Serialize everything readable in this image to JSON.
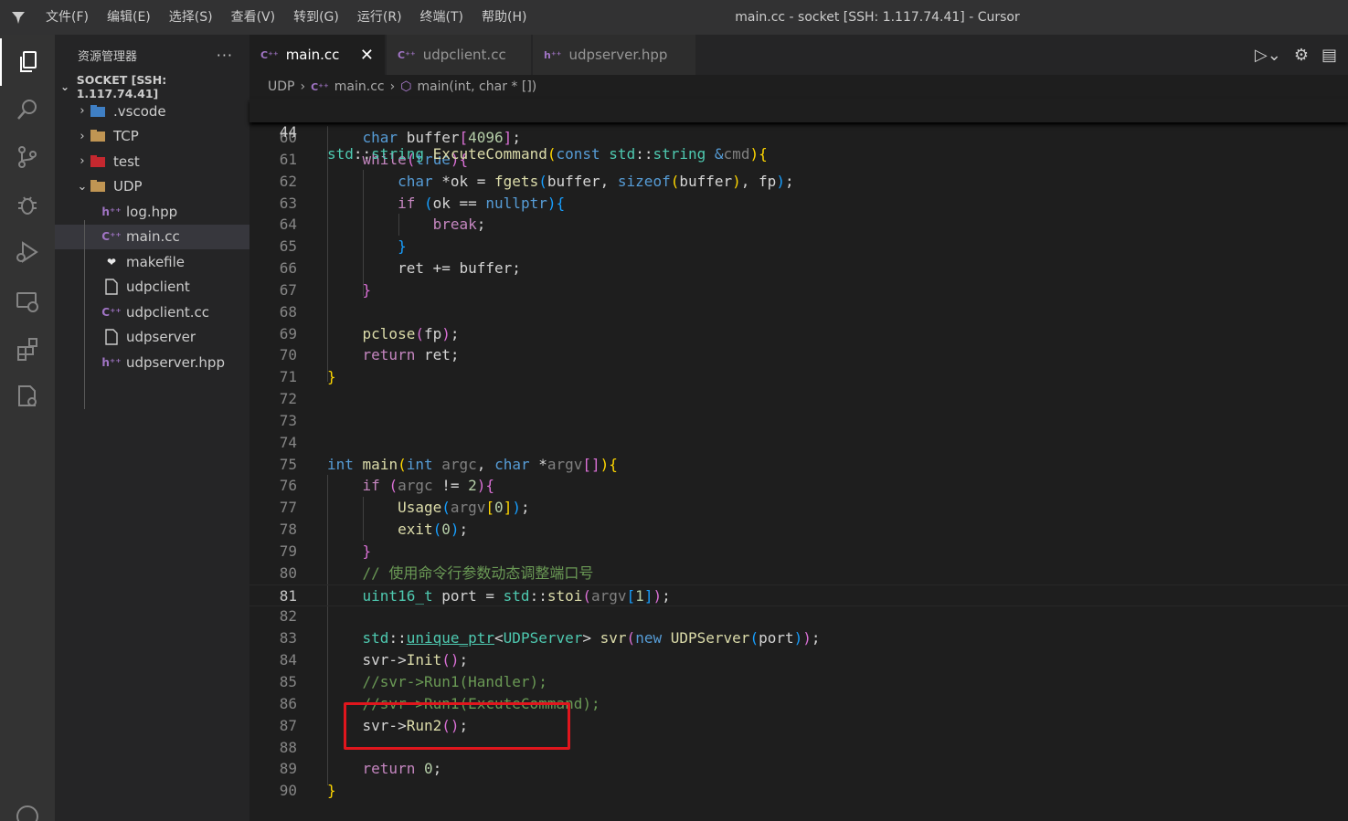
{
  "titlebar": {
    "menu": [
      "文件(F)",
      "编辑(E)",
      "选择(S)",
      "查看(V)",
      "转到(G)",
      "运行(R)",
      "终端(T)",
      "帮助(H)"
    ],
    "window_title": "main.cc - socket [SSH: 1.117.74.41] - Cursor"
  },
  "activitybar": {
    "icons": [
      "explorer-icon",
      "search-icon",
      "source-control-icon",
      "debug-icon",
      "run-debug-icon",
      "remote-explorer-icon",
      "extensions-icon",
      "remote-settings-icon"
    ]
  },
  "sidebar": {
    "title": "资源管理器",
    "more": "···",
    "section_title": "SOCKET [SSH: 1.117.74.41]",
    "items": [
      {
        "label": ".vscode",
        "type": "folder"
      },
      {
        "label": "TCP",
        "type": "folder"
      },
      {
        "label": "test",
        "type": "folder"
      },
      {
        "label": "UDP",
        "type": "folder-open"
      },
      {
        "label": "log.hpp",
        "type": "hpp"
      },
      {
        "label": "main.cc",
        "type": "cc"
      },
      {
        "label": "makefile",
        "type": "makefile"
      },
      {
        "label": "udpclient",
        "type": "file"
      },
      {
        "label": "udpclient.cc",
        "type": "cc"
      },
      {
        "label": "udpserver",
        "type": "file"
      },
      {
        "label": "udpserver.hpp",
        "type": "hpp"
      }
    ]
  },
  "tabs": [
    {
      "label": "main.cc",
      "active": true,
      "close": "✕"
    },
    {
      "label": "udpclient.cc",
      "active": false
    },
    {
      "label": "udpserver.hpp",
      "active": false
    }
  ],
  "breadcrumb": {
    "folder": "UDP",
    "file": "main.cc",
    "symbol": "main(int, char * [])"
  },
  "editor": {
    "sticky_line_number": "44",
    "line_numbers": [
      "60",
      "61",
      "62",
      "63",
      "64",
      "65",
      "66",
      "67",
      "68",
      "69",
      "70",
      "71",
      "72",
      "73",
      "74",
      "75",
      "76",
      "77",
      "78",
      "79",
      "80",
      "81",
      "82",
      "83",
      "84",
      "85",
      "86",
      "87",
      "88",
      "89",
      "90"
    ],
    "comment_chinese": "// 使用命令行参数动态调整端口号"
  },
  "colors": {
    "accent_box": "#e0161d",
    "editor_bg": "#1e1e1e",
    "sidebar_bg": "#252526"
  }
}
